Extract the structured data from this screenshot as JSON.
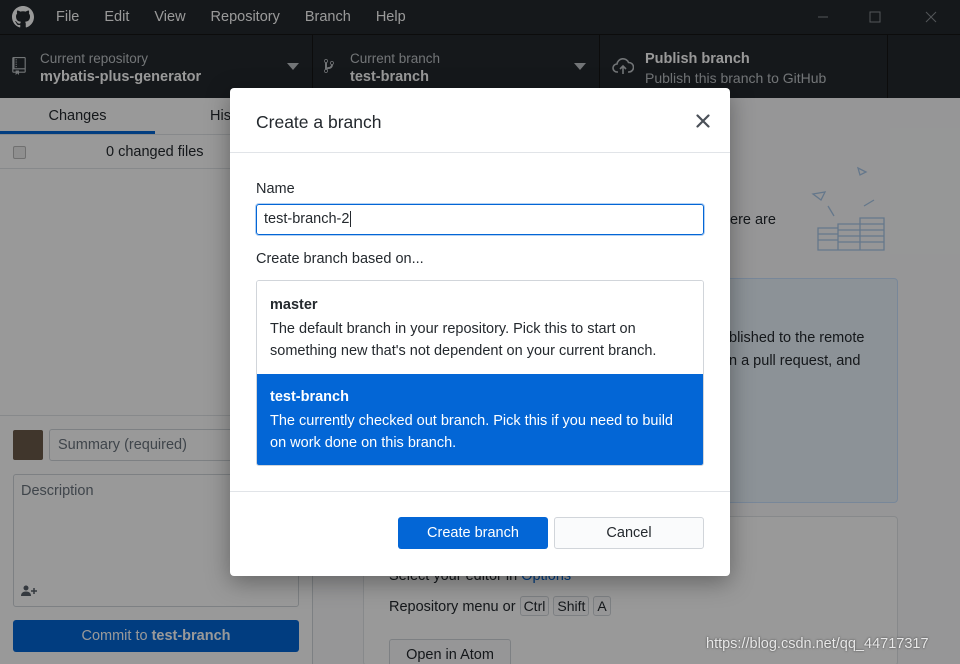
{
  "titlebar": {
    "menu": [
      "File",
      "Edit",
      "View",
      "Repository",
      "Branch",
      "Help"
    ]
  },
  "toolbar": {
    "repo_label": "Current repository",
    "repo_value": "mybatis-plus-generator",
    "branch_label": "Current branch",
    "branch_value": "test-branch",
    "publish_title": "Publish branch",
    "publish_desc": "Publish this branch to GitHub"
  },
  "sidebar": {
    "tabs": [
      "Changes",
      "His"
    ],
    "changed_files": "0 changed files",
    "summary_placeholder": "Summary (required)",
    "description_placeholder": "Description",
    "commit_prefix": "Commit to ",
    "commit_branch": "test-branch"
  },
  "main": {
    "text_there_are": "ere are",
    "text_published": "blished to the remote",
    "text_pull_request": "n a pull request, and",
    "editor_text": "Select your editor in ",
    "editor_link": "Options",
    "repo_menu_text": "Repository menu or",
    "keys": [
      "Ctrl",
      "Shift",
      "A"
    ],
    "open_atom": "Open in Atom"
  },
  "dialog": {
    "title": "Create a branch",
    "name_label": "Name",
    "name_value": "test-branch-2",
    "based_on_label": "Create branch based on...",
    "options": [
      {
        "name": "master",
        "desc": "The default branch in your repository. Pick this to start on something new that's not dependent on your current branch."
      },
      {
        "name": "test-branch",
        "desc": "The currently checked out branch. Pick this if you need to build on work done on this branch."
      }
    ],
    "create_label": "Create branch",
    "cancel_label": "Cancel"
  },
  "watermark": "https://blog.csdn.net/qq_44717317",
  "colors": {
    "titlebar_bg": "#24292e",
    "accent": "#0366d6",
    "selected_bg": "#0366d6",
    "link": "#0366d6"
  },
  "icons": [
    "github-logo-icon",
    "repo-icon",
    "branch-icon",
    "cloud-upload-icon",
    "chevron-down-icon",
    "close-icon",
    "minimize-icon",
    "maximize-icon",
    "checkbox-icon",
    "add-coauthor-icon"
  ]
}
